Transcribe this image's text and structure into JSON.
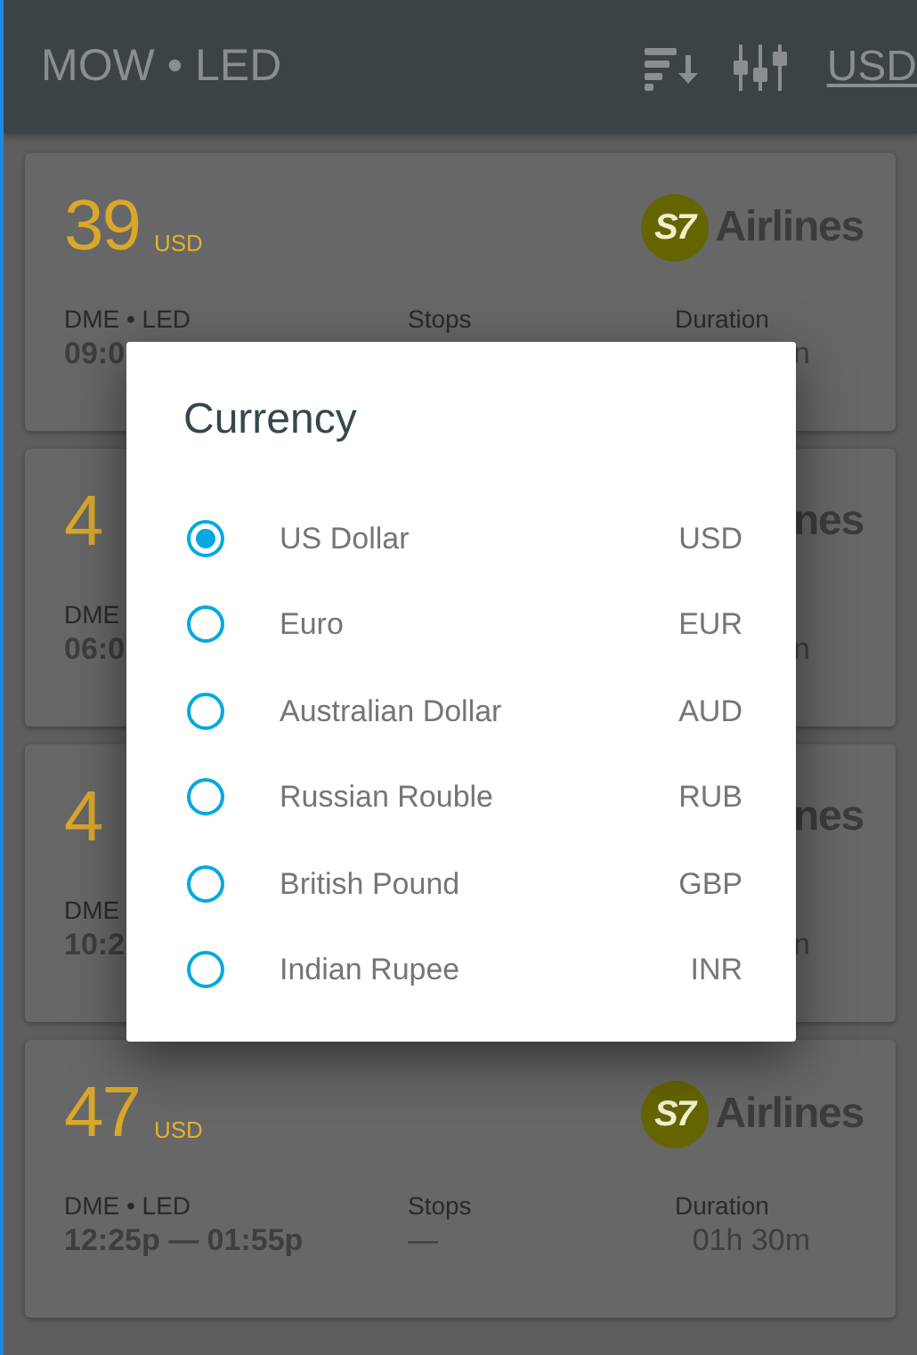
{
  "header": {
    "title": "MOW • LED",
    "currency": "USD"
  },
  "cards": [
    {
      "price": "39",
      "currency": "USD",
      "logo_mark": "S7",
      "airline": "Airlines",
      "route": "DME • LED",
      "times": "09:0",
      "stops_label": "Stops",
      "duration_label": "Duration",
      "duration": "n"
    },
    {
      "price": "4",
      "airline": "nes",
      "route": "DME",
      "times": "06:0",
      "duration": "n"
    },
    {
      "price": "4",
      "airline": "nes",
      "route": "DME",
      "times": "10:2",
      "duration": "n"
    },
    {
      "price": "47",
      "currency": "USD",
      "logo_mark": "S7",
      "airline": "Airlines",
      "route": "DME • LED",
      "times": "12:25p — 01:55p",
      "stops_label": "Stops",
      "stops": "—",
      "duration_label": "Duration",
      "duration": "01h 30m"
    }
  ],
  "dialog": {
    "title": "Currency",
    "options": [
      {
        "label": "US Dollar",
        "code": "USD",
        "selected": true
      },
      {
        "label": "Euro",
        "code": "EUR",
        "selected": false
      },
      {
        "label": "Australian Dollar",
        "code": "AUD",
        "selected": false
      },
      {
        "label": "Russian Rouble",
        "code": "RUB",
        "selected": false
      },
      {
        "label": "British Pound",
        "code": "GBP",
        "selected": false
      },
      {
        "label": "Indian Rupee",
        "code": "INR",
        "selected": false
      }
    ]
  }
}
